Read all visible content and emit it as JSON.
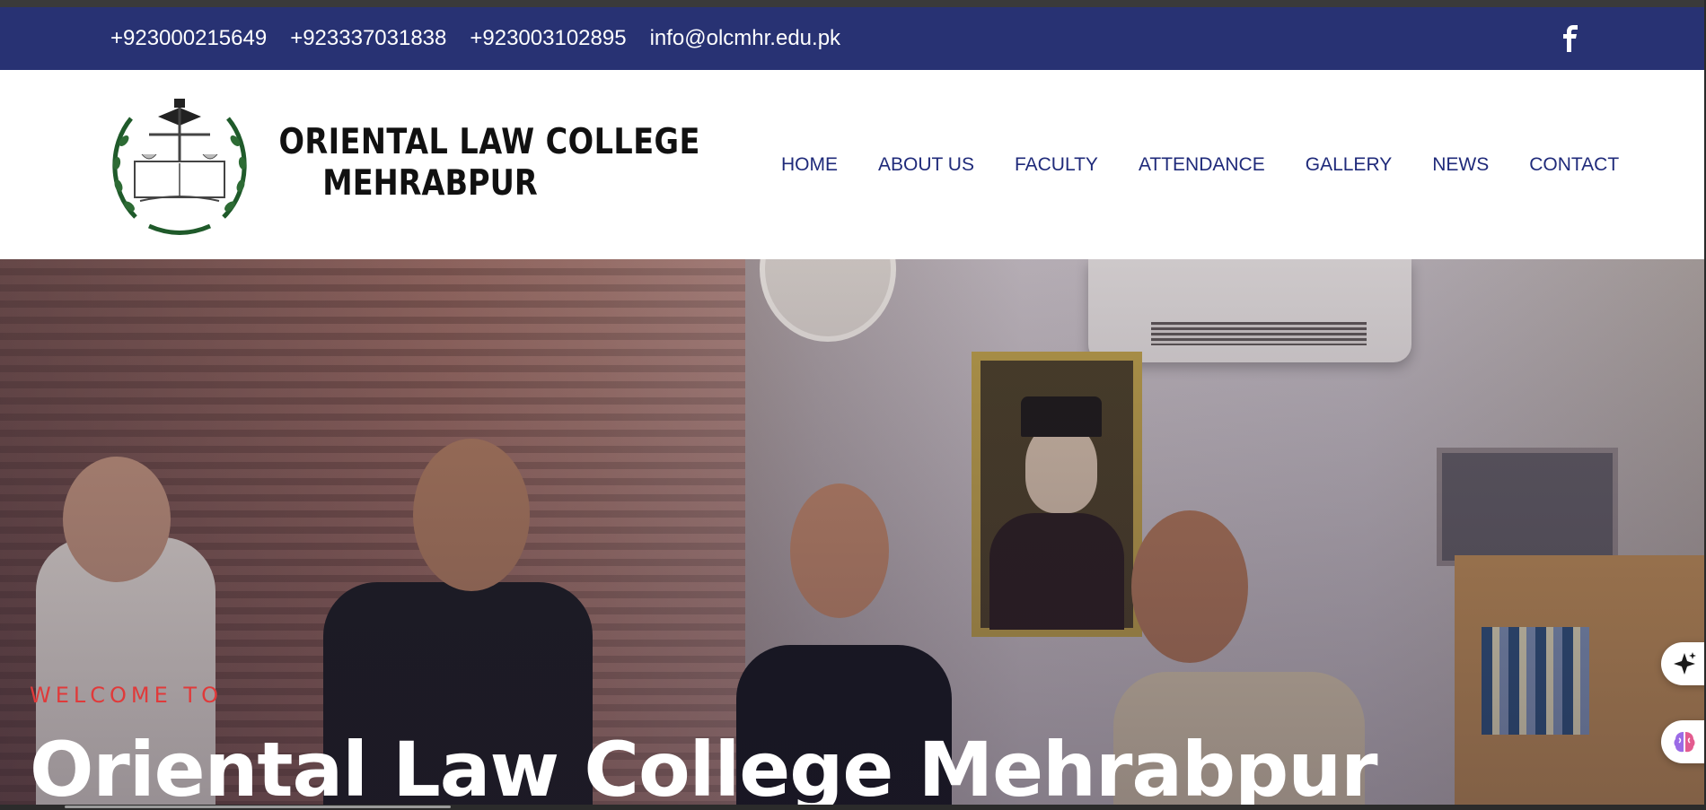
{
  "topbar": {
    "phones": [
      "+923000215649",
      "+923337031838",
      "+923003102895"
    ],
    "email": "info@olcmhr.edu.pk",
    "social_icon": "facebook-icon",
    "bg_color": "#283273"
  },
  "header": {
    "logo_icon": "college-emblem-icon",
    "brand_line1": "ORIENTAL LAW COLLEGE",
    "brand_line2": "MEHRABPUR"
  },
  "nav": {
    "items": [
      "HOME",
      "ABOUT US",
      "FACULTY",
      "ATTENDANCE",
      "GALLERY",
      "NEWS",
      "CONTACT"
    ],
    "color": "#1f2a7a"
  },
  "hero": {
    "eyebrow": "WELCOME TO",
    "title": "Oriental Law College Mehrabpur",
    "eyebrow_color": "#e03a3a"
  },
  "floating": {
    "sparkle_icon": "sparkle-icon",
    "brain_icon": "brain-icon"
  }
}
